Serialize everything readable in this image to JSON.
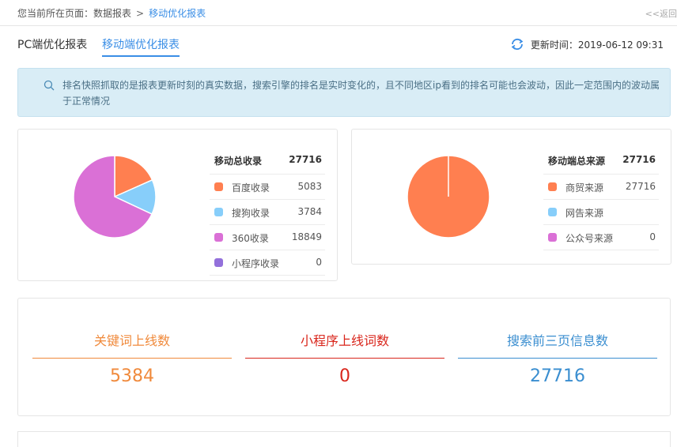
{
  "breadcrumb": {
    "prefix": "您当前所在页面：数据报表",
    "separator": ">",
    "current": "移动优化报表",
    "back": "<<返回"
  },
  "tabs": [
    {
      "label": "PC端优化报表",
      "active": false
    },
    {
      "label": "移动端优化报表",
      "active": true
    }
  ],
  "update": {
    "icon": "refresh-icon",
    "text": "更新时间：2019-06-12 09:31"
  },
  "notice": {
    "icon": "search-icon",
    "text": "排名快照抓取的是报表更新时刻的真实数据，搜索引擎的排名是实时变化的，且不同地区ip看到的排名可能也会波动，因此一定范围内的波动属于正常情况"
  },
  "collection_card": {
    "title": "移动总收录",
    "total": "27716",
    "items": [
      {
        "label": "百度收录",
        "value": "5083",
        "color": "#ff7f50"
      },
      {
        "label": "搜狗收录",
        "value": "3784",
        "color": "#87cefa"
      },
      {
        "label": "360收录",
        "value": "18849",
        "color": "#da70d6"
      },
      {
        "label": "小程序收录",
        "value": "0",
        "color": "#9370db"
      }
    ]
  },
  "source_card": {
    "title": "移动端总来源",
    "total": "27716",
    "items": [
      {
        "label": "商贸来源",
        "value": "27716",
        "color": "#ff7f50"
      },
      {
        "label": "网告来源",
        "value": "",
        "color": "#87cefa"
      },
      {
        "label": "公众号来源",
        "value": "0",
        "color": "#da70d6"
      }
    ]
  },
  "stats": [
    {
      "title": "关键词上线数",
      "value": "5384",
      "color": "#f08a3c"
    },
    {
      "title": "小程序上线词数",
      "value": "0",
      "color": "#d9261c"
    },
    {
      "title": "搜索前三页信息数",
      "value": "27716",
      "color": "#3a8ed0"
    }
  ]
}
